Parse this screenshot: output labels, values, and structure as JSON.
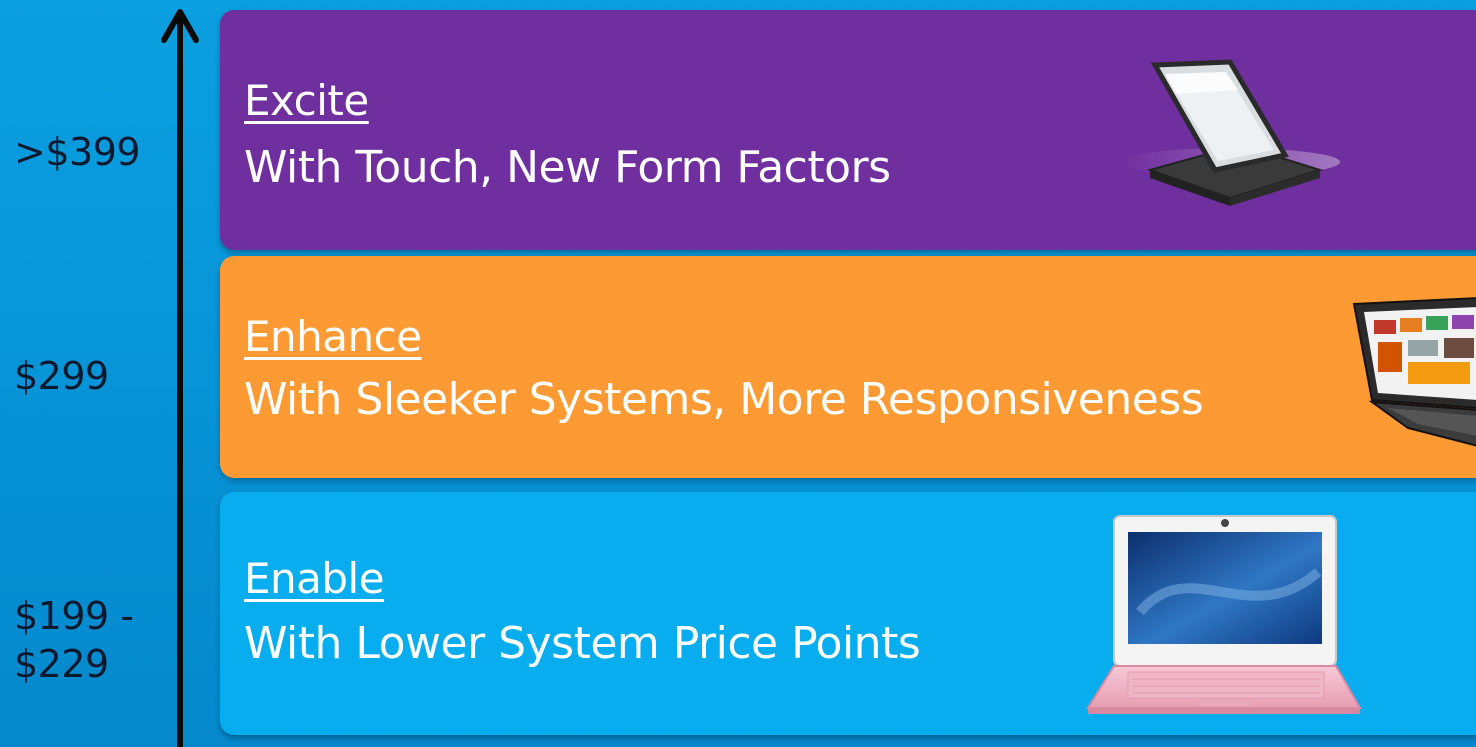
{
  "price_axis": {
    "labels": [
      {
        "text": ">$399"
      },
      {
        "text": "$299"
      },
      {
        "lines": [
          "$199 -",
          "$229"
        ]
      }
    ]
  },
  "tiers": [
    {
      "title": "Excite",
      "description": "With Touch, New Form Factors",
      "color": "#702f9f",
      "device_icon": "convertible-tablet-icon"
    },
    {
      "title": "Enhance",
      "description": "With Sleeker Systems, More Responsiveness",
      "color": "#fd9a33",
      "device_icon": "slim-laptop-icon"
    },
    {
      "title": "Enable",
      "description": "With Lower System Price Points",
      "color": "#07adee",
      "device_icon": "netbook-icon"
    }
  ]
}
